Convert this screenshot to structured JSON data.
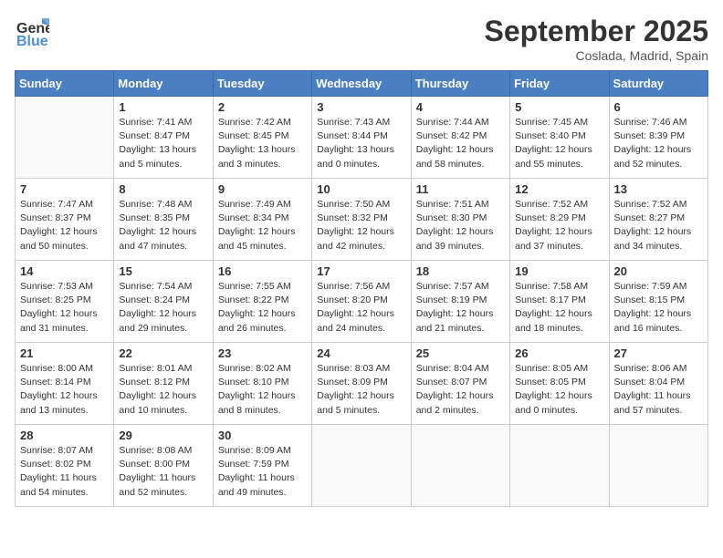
{
  "header": {
    "logo_general": "General",
    "logo_blue": "Blue",
    "title": "September 2025",
    "location": "Coslada, Madrid, Spain"
  },
  "days_of_week": [
    "Sunday",
    "Monday",
    "Tuesday",
    "Wednesday",
    "Thursday",
    "Friday",
    "Saturday"
  ],
  "weeks": [
    [
      {
        "day": "",
        "lines": []
      },
      {
        "day": "1",
        "lines": [
          "Sunrise: 7:41 AM",
          "Sunset: 8:47 PM",
          "Daylight: 13 hours",
          "and 5 minutes."
        ]
      },
      {
        "day": "2",
        "lines": [
          "Sunrise: 7:42 AM",
          "Sunset: 8:45 PM",
          "Daylight: 13 hours",
          "and 3 minutes."
        ]
      },
      {
        "day": "3",
        "lines": [
          "Sunrise: 7:43 AM",
          "Sunset: 8:44 PM",
          "Daylight: 13 hours",
          "and 0 minutes."
        ]
      },
      {
        "day": "4",
        "lines": [
          "Sunrise: 7:44 AM",
          "Sunset: 8:42 PM",
          "Daylight: 12 hours",
          "and 58 minutes."
        ]
      },
      {
        "day": "5",
        "lines": [
          "Sunrise: 7:45 AM",
          "Sunset: 8:40 PM",
          "Daylight: 12 hours",
          "and 55 minutes."
        ]
      },
      {
        "day": "6",
        "lines": [
          "Sunrise: 7:46 AM",
          "Sunset: 8:39 PM",
          "Daylight: 12 hours",
          "and 52 minutes."
        ]
      }
    ],
    [
      {
        "day": "7",
        "lines": [
          "Sunrise: 7:47 AM",
          "Sunset: 8:37 PM",
          "Daylight: 12 hours",
          "and 50 minutes."
        ]
      },
      {
        "day": "8",
        "lines": [
          "Sunrise: 7:48 AM",
          "Sunset: 8:35 PM",
          "Daylight: 12 hours",
          "and 47 minutes."
        ]
      },
      {
        "day": "9",
        "lines": [
          "Sunrise: 7:49 AM",
          "Sunset: 8:34 PM",
          "Daylight: 12 hours",
          "and 45 minutes."
        ]
      },
      {
        "day": "10",
        "lines": [
          "Sunrise: 7:50 AM",
          "Sunset: 8:32 PM",
          "Daylight: 12 hours",
          "and 42 minutes."
        ]
      },
      {
        "day": "11",
        "lines": [
          "Sunrise: 7:51 AM",
          "Sunset: 8:30 PM",
          "Daylight: 12 hours",
          "and 39 minutes."
        ]
      },
      {
        "day": "12",
        "lines": [
          "Sunrise: 7:52 AM",
          "Sunset: 8:29 PM",
          "Daylight: 12 hours",
          "and 37 minutes."
        ]
      },
      {
        "day": "13",
        "lines": [
          "Sunrise: 7:52 AM",
          "Sunset: 8:27 PM",
          "Daylight: 12 hours",
          "and 34 minutes."
        ]
      }
    ],
    [
      {
        "day": "14",
        "lines": [
          "Sunrise: 7:53 AM",
          "Sunset: 8:25 PM",
          "Daylight: 12 hours",
          "and 31 minutes."
        ]
      },
      {
        "day": "15",
        "lines": [
          "Sunrise: 7:54 AM",
          "Sunset: 8:24 PM",
          "Daylight: 12 hours",
          "and 29 minutes."
        ]
      },
      {
        "day": "16",
        "lines": [
          "Sunrise: 7:55 AM",
          "Sunset: 8:22 PM",
          "Daylight: 12 hours",
          "and 26 minutes."
        ]
      },
      {
        "day": "17",
        "lines": [
          "Sunrise: 7:56 AM",
          "Sunset: 8:20 PM",
          "Daylight: 12 hours",
          "and 24 minutes."
        ]
      },
      {
        "day": "18",
        "lines": [
          "Sunrise: 7:57 AM",
          "Sunset: 8:19 PM",
          "Daylight: 12 hours",
          "and 21 minutes."
        ]
      },
      {
        "day": "19",
        "lines": [
          "Sunrise: 7:58 AM",
          "Sunset: 8:17 PM",
          "Daylight: 12 hours",
          "and 18 minutes."
        ]
      },
      {
        "day": "20",
        "lines": [
          "Sunrise: 7:59 AM",
          "Sunset: 8:15 PM",
          "Daylight: 12 hours",
          "and 16 minutes."
        ]
      }
    ],
    [
      {
        "day": "21",
        "lines": [
          "Sunrise: 8:00 AM",
          "Sunset: 8:14 PM",
          "Daylight: 12 hours",
          "and 13 minutes."
        ]
      },
      {
        "day": "22",
        "lines": [
          "Sunrise: 8:01 AM",
          "Sunset: 8:12 PM",
          "Daylight: 12 hours",
          "and 10 minutes."
        ]
      },
      {
        "day": "23",
        "lines": [
          "Sunrise: 8:02 AM",
          "Sunset: 8:10 PM",
          "Daylight: 12 hours",
          "and 8 minutes."
        ]
      },
      {
        "day": "24",
        "lines": [
          "Sunrise: 8:03 AM",
          "Sunset: 8:09 PM",
          "Daylight: 12 hours",
          "and 5 minutes."
        ]
      },
      {
        "day": "25",
        "lines": [
          "Sunrise: 8:04 AM",
          "Sunset: 8:07 PM",
          "Daylight: 12 hours",
          "and 2 minutes."
        ]
      },
      {
        "day": "26",
        "lines": [
          "Sunrise: 8:05 AM",
          "Sunset: 8:05 PM",
          "Daylight: 12 hours",
          "and 0 minutes."
        ]
      },
      {
        "day": "27",
        "lines": [
          "Sunrise: 8:06 AM",
          "Sunset: 8:04 PM",
          "Daylight: 11 hours",
          "and 57 minutes."
        ]
      }
    ],
    [
      {
        "day": "28",
        "lines": [
          "Sunrise: 8:07 AM",
          "Sunset: 8:02 PM",
          "Daylight: 11 hours",
          "and 54 minutes."
        ]
      },
      {
        "day": "29",
        "lines": [
          "Sunrise: 8:08 AM",
          "Sunset: 8:00 PM",
          "Daylight: 11 hours",
          "and 52 minutes."
        ]
      },
      {
        "day": "30",
        "lines": [
          "Sunrise: 8:09 AM",
          "Sunset: 7:59 PM",
          "Daylight: 11 hours",
          "and 49 minutes."
        ]
      },
      {
        "day": "",
        "lines": []
      },
      {
        "day": "",
        "lines": []
      },
      {
        "day": "",
        "lines": []
      },
      {
        "day": "",
        "lines": []
      }
    ]
  ]
}
